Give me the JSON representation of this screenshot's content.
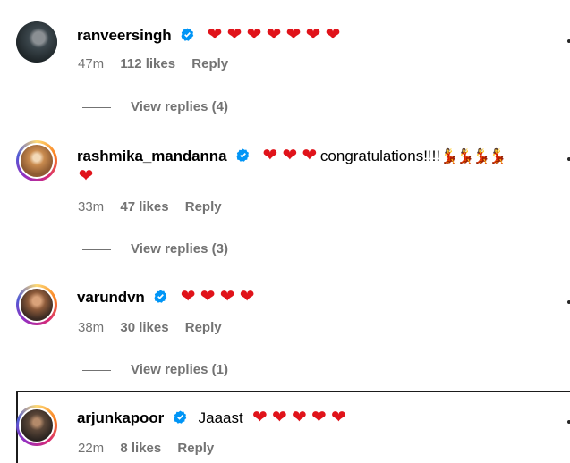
{
  "comments": [
    {
      "username": "ranveersingh",
      "text_parts": [
        "❤",
        "❤",
        "❤",
        "❤",
        "❤",
        "❤",
        "❤"
      ],
      "time": "47m",
      "likes": "112 likes",
      "reply": "Reply",
      "view_replies": "View replies (4)"
    },
    {
      "username": "rashmika_mandanna",
      "text_before": [
        "❤",
        "❤",
        "❤"
      ],
      "text": "congratulations!!!!",
      "text_after": [
        "💃",
        "💃",
        "💃",
        "💃"
      ],
      "text_line2": "❤",
      "time": "33m",
      "likes": "47 likes",
      "reply": "Reply",
      "view_replies": "View replies (3)"
    },
    {
      "username": "varundvn",
      "text_parts": [
        "❤",
        "❤",
        "❤",
        "❤"
      ],
      "time": "38m",
      "likes": "30 likes",
      "reply": "Reply",
      "view_replies": "View replies (1)"
    },
    {
      "username": "arjunkapoor",
      "text": "Jaaast",
      "text_parts": [
        "❤",
        "❤",
        "❤",
        "❤",
        "❤"
      ],
      "time": "22m",
      "likes": "8 likes",
      "reply": "Reply"
    }
  ],
  "colors": {
    "heart": "#e0131a",
    "verified": "#0095f6",
    "meta": "#737373"
  },
  "icons": {
    "verified": "verified-badge-icon",
    "heart": "heart-emoji",
    "dancer": "woman-dancing-emoji"
  }
}
